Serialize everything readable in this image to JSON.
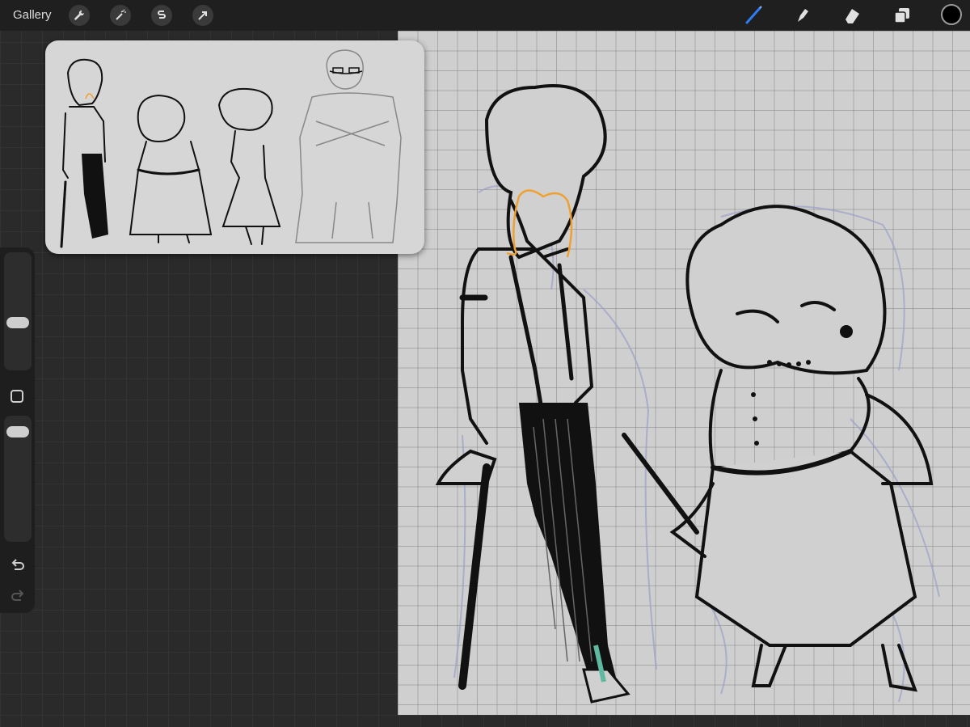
{
  "topbar": {
    "gallery_label": "Gallery",
    "left_tools": [
      "wrench-icon",
      "magic-wand-icon",
      "selection-icon",
      "transform-arrow-icon"
    ],
    "right_tools": [
      "brush-icon",
      "smudge-icon",
      "eraser-icon",
      "layers-icon"
    ],
    "active_tool": "brush-icon",
    "active_color": "#000000",
    "accent_color": "#2f7df6"
  },
  "sidebar": {
    "brush_size_level": 0.4,
    "opacity_level": 0.85,
    "modify_icon": "square-icon",
    "undo_icon": "undo-icon",
    "redo_icon": "redo-icon"
  },
  "reference_window": {
    "content": "character-lineup-reference"
  },
  "canvas": {
    "background": "#cfcfcf",
    "grid": true,
    "sketch_accent": "#f0a030"
  }
}
